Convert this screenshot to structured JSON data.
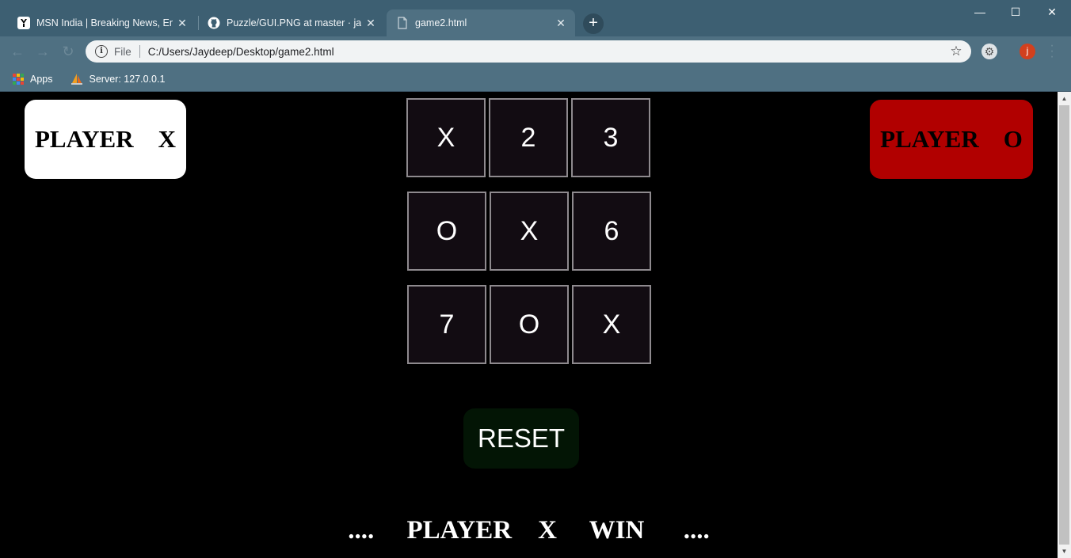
{
  "browser": {
    "tabs": [
      {
        "title": "MSN India | Breaking News, Ente",
        "active": false
      },
      {
        "title": "Puzzle/GUI.PNG at master · jaydi",
        "active": false
      },
      {
        "title": "game2.html",
        "active": true
      }
    ],
    "address": {
      "scheme_label": "File",
      "url": "C:/Users/Jaydeep/Desktop/game2.html"
    },
    "bookmarks": [
      {
        "label": "Apps"
      },
      {
        "label": "Server: 127.0.0.1"
      }
    ],
    "avatar_initial": "j",
    "colors": {
      "frame": "#3d5f72",
      "toolbar": "#4f7082"
    }
  },
  "game": {
    "player_x_label": "PLAYER    X",
    "player_o_label": "PLAYER    O",
    "board": [
      [
        "X",
        "2",
        "3"
      ],
      [
        "O",
        "X",
        "6"
      ],
      [
        "7",
        "O",
        "X"
      ]
    ],
    "reset_label": "RESET",
    "status": "....     PLAYER    X     WIN      ....",
    "colors": {
      "player_x_card": "#ffffff",
      "player_o_card": "#b10000",
      "cell_bg": "#120c12",
      "reset_bg": "#031505"
    }
  }
}
